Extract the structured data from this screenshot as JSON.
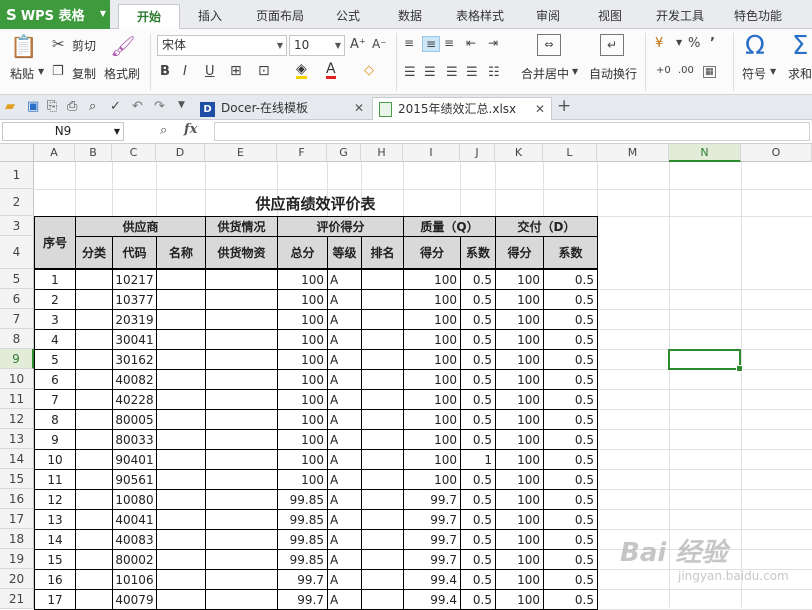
{
  "app": {
    "name": "WPS 表格",
    "logo": "S"
  },
  "menu_tabs": [
    "开始",
    "插入",
    "页面布局",
    "公式",
    "数据",
    "表格样式",
    "审阅",
    "视图",
    "开发工具",
    "特色功能"
  ],
  "active_tab": "开始",
  "ribbon": {
    "paste": "粘贴",
    "cut": "剪切",
    "copy": "复制",
    "format_painter": "格式刷",
    "font_name": "宋体",
    "font_size": "10",
    "bold": "B",
    "italic": "I",
    "underline": "U",
    "merge_center": "合并居中",
    "wrap_text": "自动换行",
    "symbol": "符号",
    "sum": "求和",
    "percent": "%",
    "comma": "’",
    "increase_font": "A⁺",
    "decrease_font": "A⁻",
    "accent_color": "#3d9b3d"
  },
  "doc_tabs": [
    {
      "label": "Docer-在线模板",
      "icon": "docer-icon"
    },
    {
      "label": "2015年绩效汇总.xlsx",
      "icon": "spreadsheet-file-icon"
    }
  ],
  "formula_bar": {
    "name_box": "N9",
    "fx": "fx",
    "formula": ""
  },
  "columns": [
    "A",
    "B",
    "C",
    "D",
    "E",
    "F",
    "G",
    "H",
    "I",
    "J",
    "K",
    "L",
    "M",
    "N",
    "O"
  ],
  "selected_cell": {
    "col": "N",
    "row": "9"
  },
  "sheet": {
    "title": "供应商绩效评价表",
    "group_headers": {
      "seq": "序号",
      "supplier": "供应商",
      "supply": "供货情况",
      "evaluation": "评价得分",
      "quality": "质量（Q）",
      "delivery": "交付（D）"
    },
    "sub_headers": {
      "category": "分类",
      "code": "代码",
      "name": "名称",
      "goods": "供货物资",
      "total": "总分",
      "grade": "等级",
      "rank": "排名",
      "q_score": "得分",
      "q_coef": "系数",
      "d_score": "得分",
      "d_coef": "系数"
    },
    "rows": [
      {
        "row": "5",
        "seq": "1",
        "code": "10217",
        "total": "100",
        "grade": "A",
        "q": "100",
        "qc": "0.5",
        "d": "100",
        "dc": "0.5"
      },
      {
        "row": "6",
        "seq": "2",
        "code": "10377",
        "total": "100",
        "grade": "A",
        "q": "100",
        "qc": "0.5",
        "d": "100",
        "dc": "0.5"
      },
      {
        "row": "7",
        "seq": "3",
        "code": "20319",
        "total": "100",
        "grade": "A",
        "q": "100",
        "qc": "0.5",
        "d": "100",
        "dc": "0.5"
      },
      {
        "row": "8",
        "seq": "4",
        "code": "30041",
        "total": "100",
        "grade": "A",
        "q": "100",
        "qc": "0.5",
        "d": "100",
        "dc": "0.5"
      },
      {
        "row": "9",
        "seq": "5",
        "code": "30162",
        "total": "100",
        "grade": "A",
        "q": "100",
        "qc": "0.5",
        "d": "100",
        "dc": "0.5"
      },
      {
        "row": "10",
        "seq": "6",
        "code": "40082",
        "total": "100",
        "grade": "A",
        "q": "100",
        "qc": "0.5",
        "d": "100",
        "dc": "0.5"
      },
      {
        "row": "11",
        "seq": "7",
        "code": "40228",
        "total": "100",
        "grade": "A",
        "q": "100",
        "qc": "0.5",
        "d": "100",
        "dc": "0.5"
      },
      {
        "row": "12",
        "seq": "8",
        "code": "80005",
        "total": "100",
        "grade": "A",
        "q": "100",
        "qc": "0.5",
        "d": "100",
        "dc": "0.5"
      },
      {
        "row": "13",
        "seq": "9",
        "code": "80033",
        "total": "100",
        "grade": "A",
        "q": "100",
        "qc": "0.5",
        "d": "100",
        "dc": "0.5"
      },
      {
        "row": "14",
        "seq": "10",
        "code": "90401",
        "total": "100",
        "grade": "A",
        "q": "100",
        "qc": "1",
        "d": "100",
        "dc": "0.5"
      },
      {
        "row": "15",
        "seq": "11",
        "code": "90561",
        "total": "100",
        "grade": "A",
        "q": "100",
        "qc": "0.5",
        "d": "100",
        "dc": "0.5"
      },
      {
        "row": "16",
        "seq": "12",
        "code": "10080",
        "total": "99.85",
        "grade": "A",
        "q": "99.7",
        "qc": "0.5",
        "d": "100",
        "dc": "0.5"
      },
      {
        "row": "17",
        "seq": "13",
        "code": "40041",
        "total": "99.85",
        "grade": "A",
        "q": "99.7",
        "qc": "0.5",
        "d": "100",
        "dc": "0.5"
      },
      {
        "row": "18",
        "seq": "14",
        "code": "40083",
        "total": "99.85",
        "grade": "A",
        "q": "99.7",
        "qc": "0.5",
        "d": "100",
        "dc": "0.5"
      },
      {
        "row": "19",
        "seq": "15",
        "code": "80002",
        "total": "99.85",
        "grade": "A",
        "q": "99.7",
        "qc": "0.5",
        "d": "100",
        "dc": "0.5"
      },
      {
        "row": "20",
        "seq": "16",
        "code": "10106",
        "total": "99.7",
        "grade": "A",
        "q": "99.4",
        "qc": "0.5",
        "d": "100",
        "dc": "0.5"
      },
      {
        "row": "21",
        "seq": "17",
        "code": "40079",
        "total": "99.7",
        "grade": "A",
        "q": "99.4",
        "qc": "0.5",
        "d": "100",
        "dc": "0.5"
      }
    ]
  },
  "watermark": {
    "brand": "Bai 经验",
    "url": "jingyan.baidu.com"
  }
}
